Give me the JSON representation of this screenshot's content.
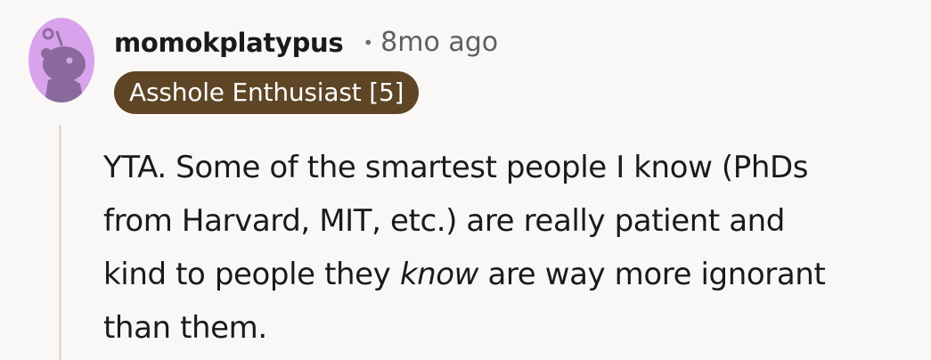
{
  "comment": {
    "username": "momokplatypus",
    "separator": "•",
    "timestamp": "8mo ago",
    "flair": "Asshole Enthusiast [5]",
    "body": {
      "line1": "YTA. Some of the smartest people I know (PhDs",
      "line2": "from Harvard, MIT, etc.) are really patient and",
      "line3_before": "kind to people they ",
      "line3_emphasis": "know",
      "line3_after": " are way more ignorant",
      "line4": "than them."
    }
  },
  "colors": {
    "background": "#faf8f7",
    "avatar_bg": "#d8a3ec",
    "avatar_figure": "#8a6a9c",
    "flair_bg": "#5d4525",
    "flair_text": "#ffffff",
    "thread_line": "#e0dbd6"
  },
  "icons": {
    "avatar": "snoo-avatar-icon"
  }
}
